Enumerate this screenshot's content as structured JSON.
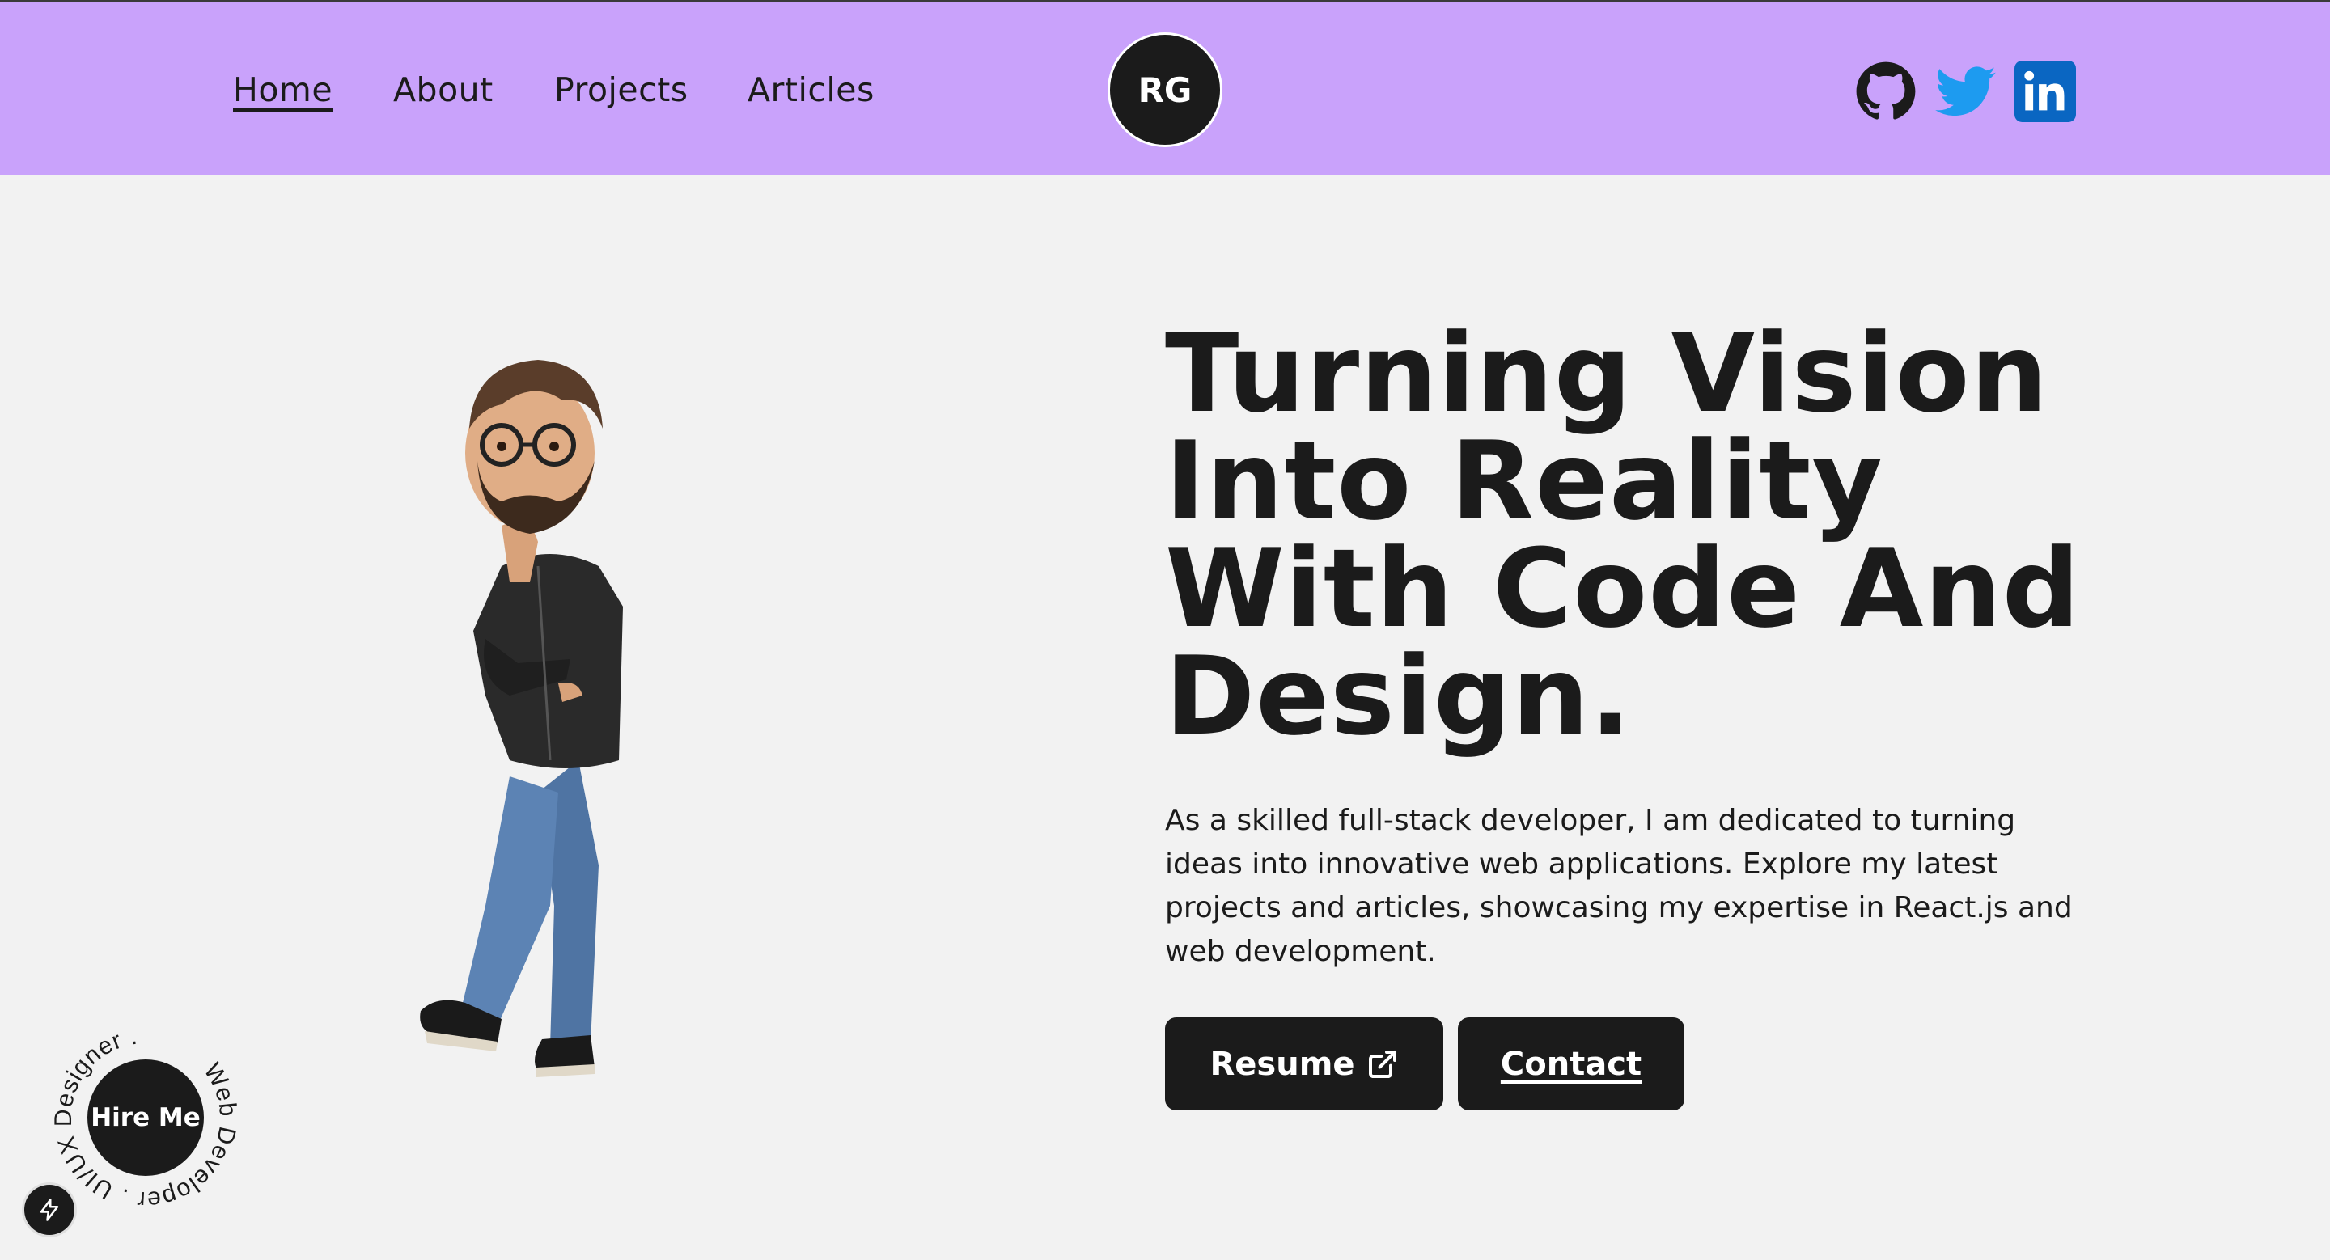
{
  "nav": {
    "items": [
      {
        "label": "Home",
        "active": true
      },
      {
        "label": "About",
        "active": false
      },
      {
        "label": "Projects",
        "active": false
      },
      {
        "label": "Articles",
        "active": false
      }
    ],
    "logo_text": "RG",
    "social": [
      {
        "icon": "github-icon",
        "color": "#1b1b1b"
      },
      {
        "icon": "twitter-icon",
        "color": "#1d9bf0"
      },
      {
        "icon": "linkedin-icon",
        "color": "#0a66c2"
      }
    ]
  },
  "hero": {
    "headline_lines": [
      "Turning Vision",
      "Into Reality",
      "With Code And",
      "Design."
    ],
    "description": "As a skilled full-stack developer, I am dedicated to turning ideas into innovative web applications. Explore my latest projects and articles, showcasing my expertise in React.js and web development.",
    "buttons": {
      "resume_label": "Resume",
      "resume_icon": "external-link-icon",
      "contact_label": "Contact"
    }
  },
  "hire_badge": {
    "label": "Hire Me",
    "ring_text": "Web Developer . UI/UX Designer ."
  },
  "colors": {
    "header_bg": "#c9a2fb",
    "page_bg": "#f2f2f2",
    "dark": "#1b1b1b"
  }
}
